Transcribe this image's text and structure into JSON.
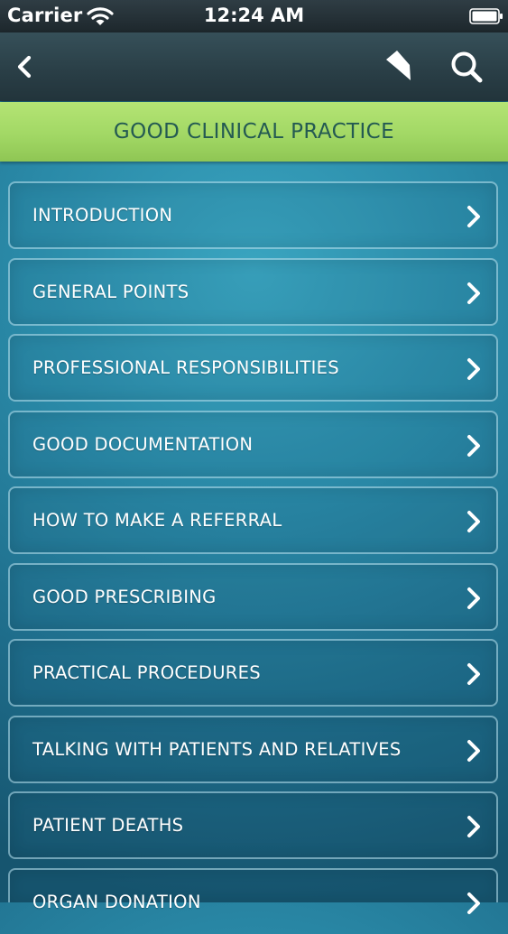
{
  "status_bar": {
    "carrier": "Carrier",
    "time": "12:24 AM"
  },
  "nav": {
    "back_icon": "chevron-left-icon",
    "bookmark_icon": "bookmark-icon",
    "search_icon": "search-icon"
  },
  "section": {
    "title": "GOOD CLINICAL PRACTICE"
  },
  "menu": {
    "items": [
      {
        "label": "INTRODUCTION"
      },
      {
        "label": "GENERAL POINTS"
      },
      {
        "label": "PROFESSIONAL RESPONSIBILITIES"
      },
      {
        "label": "GOOD DOCUMENTATION"
      },
      {
        "label": "HOW TO MAKE A REFERRAL"
      },
      {
        "label": "GOOD PRESCRIBING"
      },
      {
        "label": "PRACTICAL PROCEDURES"
      },
      {
        "label": "TALKING WITH PATIENTS AND RELATIVES"
      },
      {
        "label": "PATIENT DEATHS"
      },
      {
        "label": "ORGAN DONATION"
      }
    ]
  },
  "colors": {
    "header_green": "#a2d865",
    "header_text": "#245a52",
    "background_teal": "#2a8aa8",
    "nav_dark": "#2a3f47"
  }
}
